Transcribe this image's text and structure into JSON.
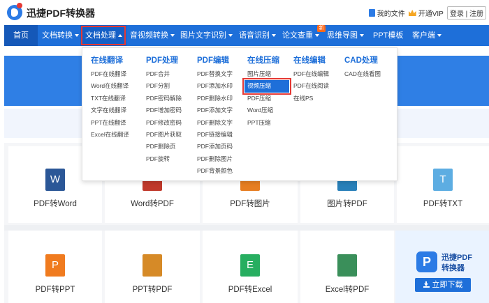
{
  "header": {
    "brand": "迅捷PDF转换器",
    "my_files": "我的文件",
    "vip": "开通VIP",
    "login": "登录",
    "separator": "|",
    "register": "注册"
  },
  "nav": {
    "items": [
      {
        "label": "首页"
      },
      {
        "label": "文档转换"
      },
      {
        "label": "文档处理"
      },
      {
        "label": "音视频转换"
      },
      {
        "label": "图片文字识别"
      },
      {
        "label": "语音识别"
      },
      {
        "label": "论文查重"
      },
      {
        "label": "思维导图"
      },
      {
        "label": "PPT模板"
      },
      {
        "label": "客户端"
      }
    ],
    "new_badge": "新",
    "accent": "#1e6fd9"
  },
  "dropdown": {
    "columns": [
      {
        "title": "在线翻译",
        "items": [
          "PDF在线翻译",
          "Word在线翻译",
          "TXT在线翻译",
          "文字在线翻译",
          "PPT在线翻译",
          "Excel在线翻译"
        ]
      },
      {
        "title": "PDF处理",
        "items": [
          "PDF合并",
          "PDF分割",
          "PDF密码解除",
          "PDF增加密码",
          "PDF修改密码",
          "PDF图片获取",
          "PDF删除页",
          "PDF旋转"
        ]
      },
      {
        "title": "PDF编辑",
        "items": [
          "PDF替换文字",
          "PDF添加水印",
          "PDF删除水印",
          "PDF添加文字",
          "PDF删除文字",
          "PDF链接编辑",
          "PDF添加页码",
          "PDF删除图片",
          "PDF背景颜色"
        ]
      },
      {
        "title": "在线压缩",
        "items": [
          "图片压缩",
          "视频压缩",
          "PDF压缩",
          "Word压缩",
          "PPT压缩"
        ]
      },
      {
        "title": "在线编辑",
        "items": [
          "PDF在线编辑",
          "PDF在线阅读",
          "在线PS"
        ]
      },
      {
        "title": "CAD处理",
        "items": [
          "CAD在线看图"
        ]
      }
    ],
    "highlighted": "视频压缩"
  },
  "cards_row1": [
    {
      "label": "PDF转Word",
      "tile": "W",
      "color": "#2b5797"
    },
    {
      "label": "Word转PDF",
      "tile": "",
      "color": "#c0392b"
    },
    {
      "label": "PDF转图片",
      "tile": "",
      "color": "#e67e22"
    },
    {
      "label": "图片转PDF",
      "tile": "",
      "color": "#2980b9"
    },
    {
      "label": "PDF转TXT",
      "tile": "T",
      "color": "#5dade2"
    }
  ],
  "cards_row2": [
    {
      "label": "PDF转PPT",
      "tile": "P",
      "color": "#f07b1f"
    },
    {
      "label": "PPT转PDF",
      "tile": "",
      "color": "#d68a27"
    },
    {
      "label": "PDF转Excel",
      "tile": "E",
      "color": "#27ae60"
    },
    {
      "label": "Excel转PDF",
      "tile": "",
      "color": "#3a8f5a"
    }
  ],
  "promo": {
    "line1": "迅捷PDF",
    "line2": "转换器",
    "button": "立即下载"
  }
}
